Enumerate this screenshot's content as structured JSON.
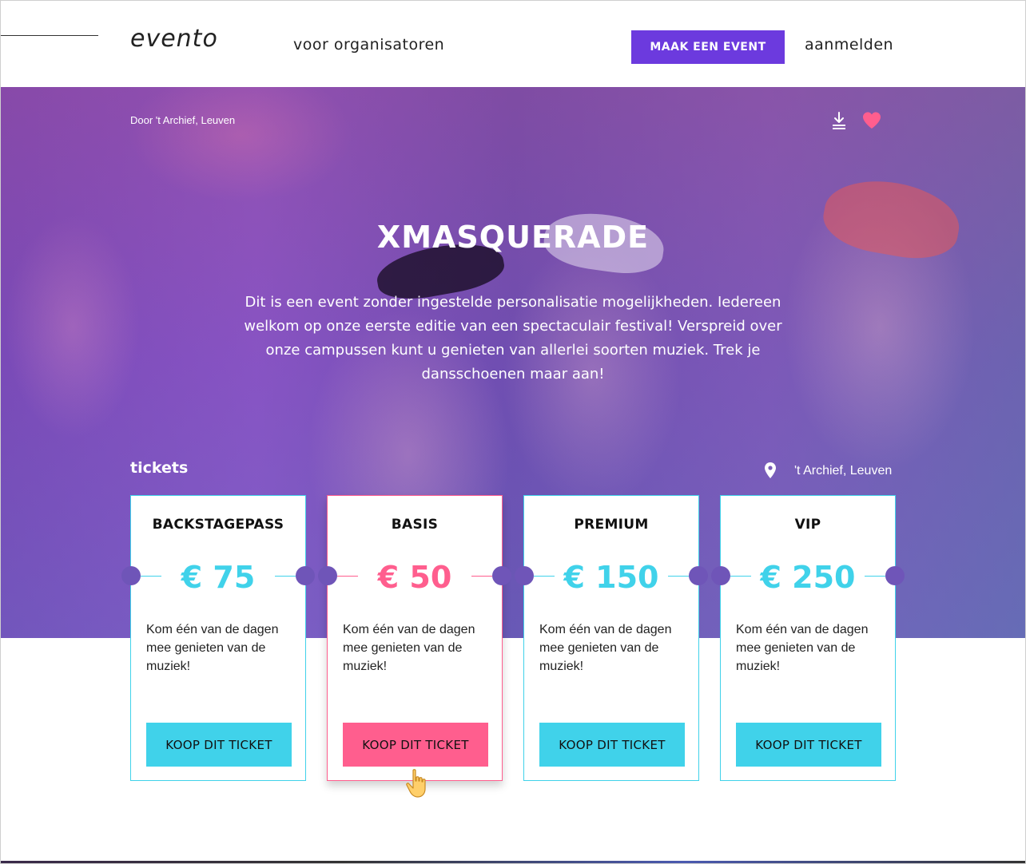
{
  "header": {
    "logo": "evento",
    "nav_organizers": "voor organisatoren",
    "make_event": "MAAK EEN EVENT",
    "login": "aanmelden"
  },
  "hero": {
    "organizer": "Door 't Archief, Leuven",
    "title": "XMASQUERADE",
    "description": "Dit is een event zonder ingestelde personalisatie mogelijkheden. Iedereen welkom op onze eerste editie van een spectaculair festival! Verspreid over onze campussen kunt u genieten van allerlei soorten muziek. Trek je dansschoenen maar aan!",
    "tickets_label": "tickets",
    "location": "'t Archief, Leuven",
    "icons": [
      "download-icon",
      "heart-icon",
      "location-pin-icon"
    ]
  },
  "tickets": [
    {
      "name": "BACKSTAGEPASS",
      "price": "€ 75",
      "description": "Kom één van de dagen mee genieten van de muziek!",
      "button": "KOOP DIT TICKET"
    },
    {
      "name": "BASIS",
      "price": "€ 50",
      "description": "Kom één van de dagen mee genieten van de muziek!",
      "button": "KOOP DIT TICKET"
    },
    {
      "name": "PREMIUM",
      "price": "€ 150",
      "description": "Kom één van de dagen mee genieten van de muziek!",
      "button": "KOOP DIT TICKET"
    },
    {
      "name": "VIP",
      "price": "€ 250",
      "description": "Kom één van de dagen mee genieten van de muziek!",
      "button": "KOOP DIT TICKET"
    }
  ],
  "colors": {
    "primary_purple": "#6c3ade",
    "accent_cyan": "#40d2ea",
    "accent_pink": "#ff5e8e"
  }
}
